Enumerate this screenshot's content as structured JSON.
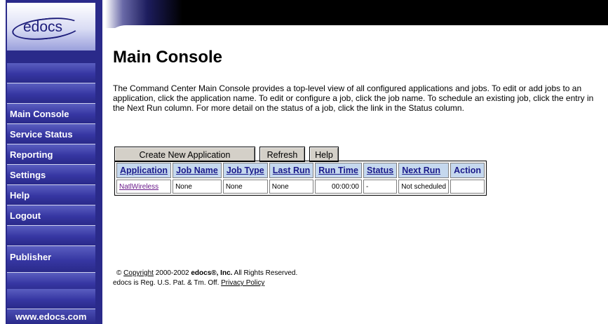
{
  "logo": {
    "text": "edocs"
  },
  "sidebar": {
    "items": [
      {
        "label": ""
      },
      {
        "label": ""
      },
      {
        "label": "Main Console"
      },
      {
        "label": "Service Status"
      },
      {
        "label": "Reporting"
      },
      {
        "label": "Settings"
      },
      {
        "label": "Help"
      },
      {
        "label": "Logout"
      },
      {
        "label": ""
      },
      {
        "label": "Publisher"
      },
      {
        "label": ""
      },
      {
        "label": ""
      }
    ],
    "website": "www.edocs.com"
  },
  "main": {
    "title": "Main Console",
    "description": "The Command Center Main Console provides a top-level view of all configured applications and jobs. To edit or add jobs to an application, click the application name. To edit or configure a job, click the job name. To schedule an existing job, click the entry in the Next Run column. For more detail on the status of a job, click the link in the Status column.",
    "buttons": {
      "create": "Create New Application",
      "refresh": "Refresh",
      "help": "Help"
    },
    "table": {
      "headers": [
        "Application",
        "Job Name",
        "Job Type",
        "Last Run",
        "Run Time",
        "Status",
        "Next Run",
        "Action"
      ],
      "rows": [
        [
          "NatlWireless",
          "None",
          "None",
          "None",
          "00:00:00",
          "-",
          "Not scheduled",
          ""
        ]
      ]
    }
  },
  "footer": {
    "copyright_symbol": "©",
    "copyright_link": "Copyright",
    "copyright_years": "2000-2002",
    "company": "edocs®, Inc.",
    "rights": "All Rights Reserved.",
    "trademark": "edocs is Reg. U.S. Pat. & Tm. Off.",
    "privacy_link": "Privacy Policy"
  }
}
